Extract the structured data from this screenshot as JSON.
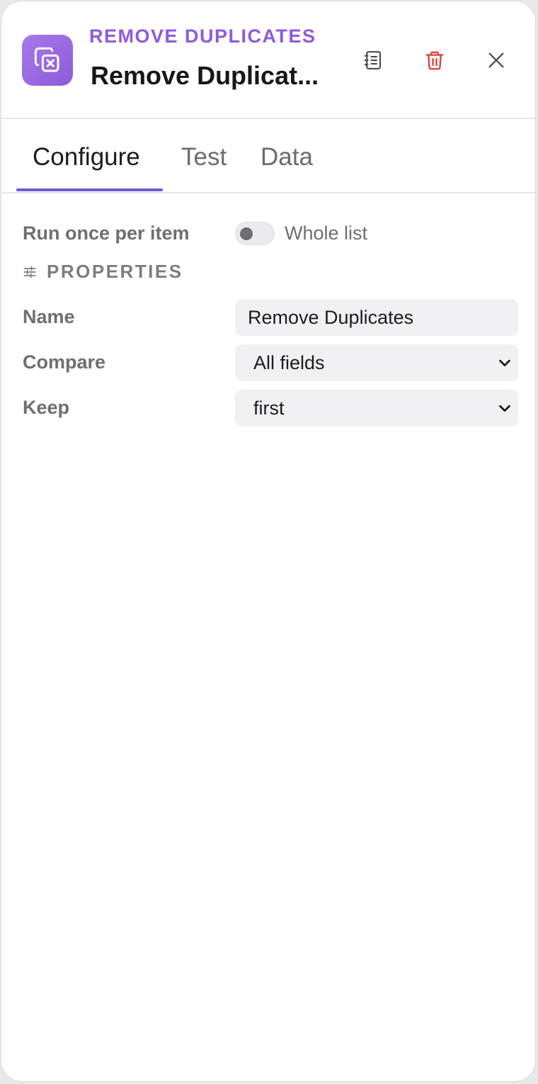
{
  "header": {
    "node_type": "REMOVE DUPLICATES",
    "node_title": "Remove Duplicat...",
    "icons": {
      "node": "copy-x-icon",
      "notes": "notebook-icon",
      "delete": "trash-icon",
      "close": "close-icon"
    },
    "colors": {
      "accent": "#8f5ae0",
      "delete": "#d9453f"
    }
  },
  "tabs": [
    {
      "label": "Configure",
      "active": true
    },
    {
      "label": "Test",
      "active": false
    },
    {
      "label": "Data",
      "active": false
    }
  ],
  "mode": {
    "label": "Run once per item",
    "toggle_label": "Whole list",
    "toggle_on": false
  },
  "properties": {
    "section_title": "PROPERTIES",
    "section_icon": "sliders-icon",
    "name": {
      "label": "Name",
      "value": "Remove Duplicates"
    },
    "compare": {
      "label": "Compare",
      "value": "All fields"
    },
    "keep": {
      "label": "Keep",
      "value": "first"
    }
  }
}
